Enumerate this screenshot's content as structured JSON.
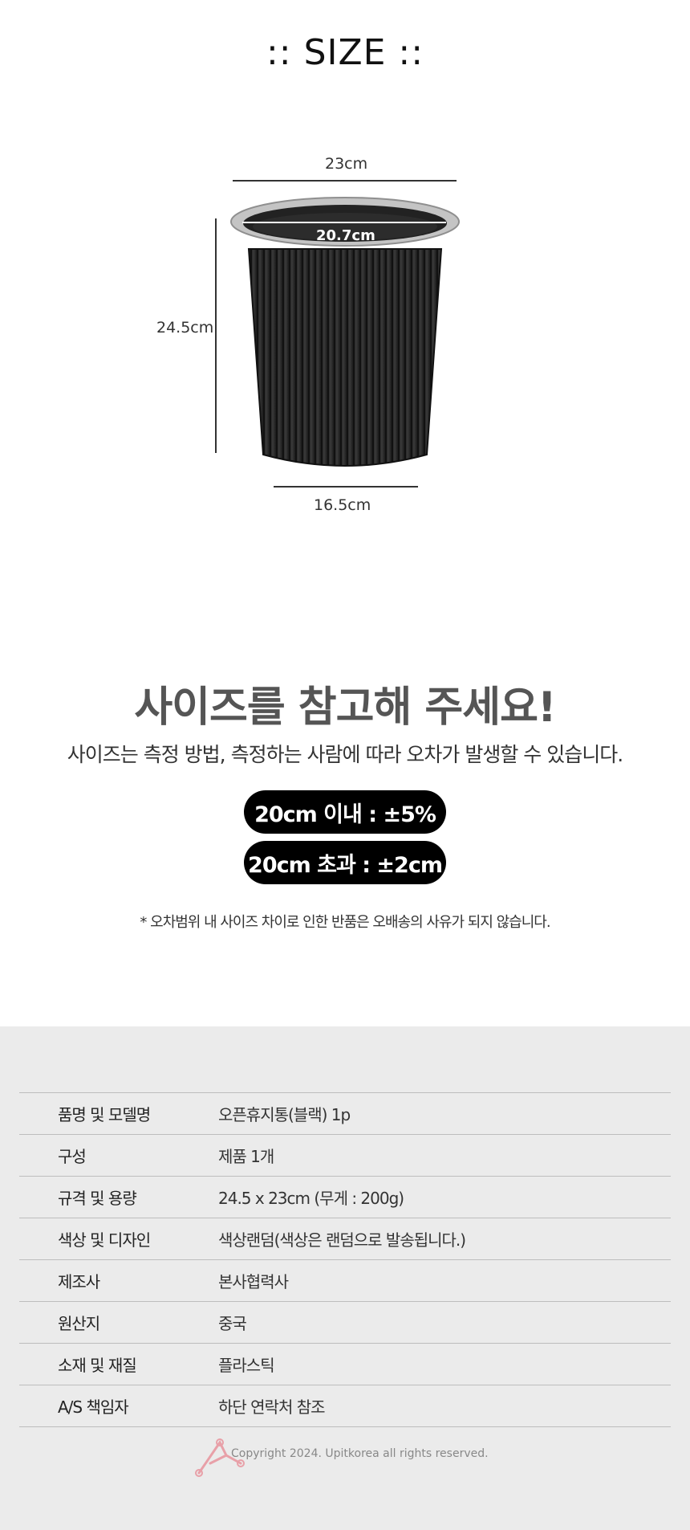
{
  "size_section": {
    "title": ":: SIZE ::",
    "top_width": "23cm",
    "inner_width": "20.7cm",
    "height": "24.5cm",
    "bottom_width": "16.5cm"
  },
  "notice": {
    "headline": "사이즈를 참고해 주세요!",
    "subline": "사이즈는 측정 방법, 측정하는 사람에 따라 오차가 발생할 수 있습니다.",
    "tolerance_1": "20cm 이내 : ±5%",
    "tolerance_2": "20cm 초과 : ±2cm",
    "disclaimer": "* 오차범위 내 사이즈 차이로 인한 반품은 오배송의 사유가 되지 않습니다."
  },
  "specs": [
    {
      "label": "품명 및 모델명",
      "value": "오픈휴지통(블랙) 1p"
    },
    {
      "label": "구성",
      "value": "제품 1개"
    },
    {
      "label": "규격 및 용량",
      "value": "24.5 x 23cm (무게 : 200g)"
    },
    {
      "label": "색상 및 디자인",
      "value": "색상랜덤(색상은 랜덤으로 발송됩니다.)"
    },
    {
      "label": "제조사",
      "value": "본사협력사"
    },
    {
      "label": "원산지",
      "value": "중국"
    },
    {
      "label": "소재 및 재질",
      "value": "플라스틱"
    },
    {
      "label": "A/S 책임자",
      "value": "하단 연락처 참조"
    }
  ],
  "footer": {
    "copyright": "Copyright 2024. Upitkorea all rights reserved.",
    "logo_icon": "upitkorea-logo-icon"
  },
  "colors": {
    "spec_background": "#ebebeb",
    "pill_background": "#000000",
    "bin_body": "#2a2a2a",
    "bin_rim": "#c4c4c4",
    "logo": "#e8a0a8"
  }
}
